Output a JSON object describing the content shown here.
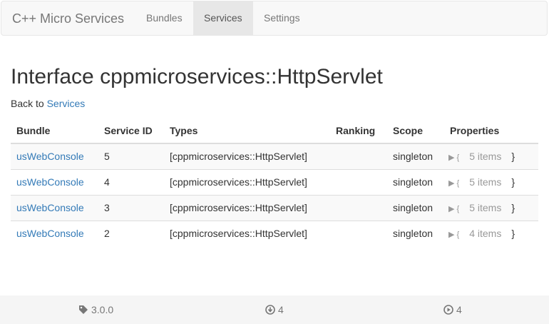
{
  "navbar": {
    "brand": "C++ Micro Services",
    "items": [
      {
        "label": "Bundles",
        "active": false
      },
      {
        "label": "Services",
        "active": true
      },
      {
        "label": "Settings",
        "active": false
      }
    ]
  },
  "page": {
    "title": "Interface cppmicroservices::HttpServlet",
    "back_prefix": "Back to",
    "back_link": "Services"
  },
  "table": {
    "headers": [
      "Bundle",
      "Service ID",
      "Types",
      "Ranking",
      "Scope",
      "Properties"
    ],
    "rows": [
      {
        "bundle": "usWebConsole",
        "service_id": "5",
        "types": "[cppmicroservices::HttpServlet]",
        "ranking": "",
        "scope": "singleton",
        "props_open": "▶ {",
        "props_count": "5 items",
        "props_close": "}"
      },
      {
        "bundle": "usWebConsole",
        "service_id": "4",
        "types": "[cppmicroservices::HttpServlet]",
        "ranking": "",
        "scope": "singleton",
        "props_open": "▶ {",
        "props_count": "5 items",
        "props_close": "}"
      },
      {
        "bundle": "usWebConsole",
        "service_id": "3",
        "types": "[cppmicroservices::HttpServlet]",
        "ranking": "",
        "scope": "singleton",
        "props_open": "▶ {",
        "props_count": "5 items",
        "props_close": "}"
      },
      {
        "bundle": "usWebConsole",
        "service_id": "2",
        "types": "[cppmicroservices::HttpServlet]",
        "ranking": "",
        "scope": "singleton",
        "props_open": "▶ {",
        "props_count": "4 items",
        "props_close": "}"
      }
    ]
  },
  "footer": {
    "version": "3.0.0",
    "bundles_count": "4",
    "services_count": "4",
    "icons": [
      "tag-icon",
      "download-circle-icon",
      "play-circle-icon"
    ]
  },
  "colors": {
    "link": "#337ab7",
    "navbar_bg": "#f8f8f8",
    "nav_active_bg": "#e7e7e7",
    "footer_bg": "#f5f5f5"
  }
}
